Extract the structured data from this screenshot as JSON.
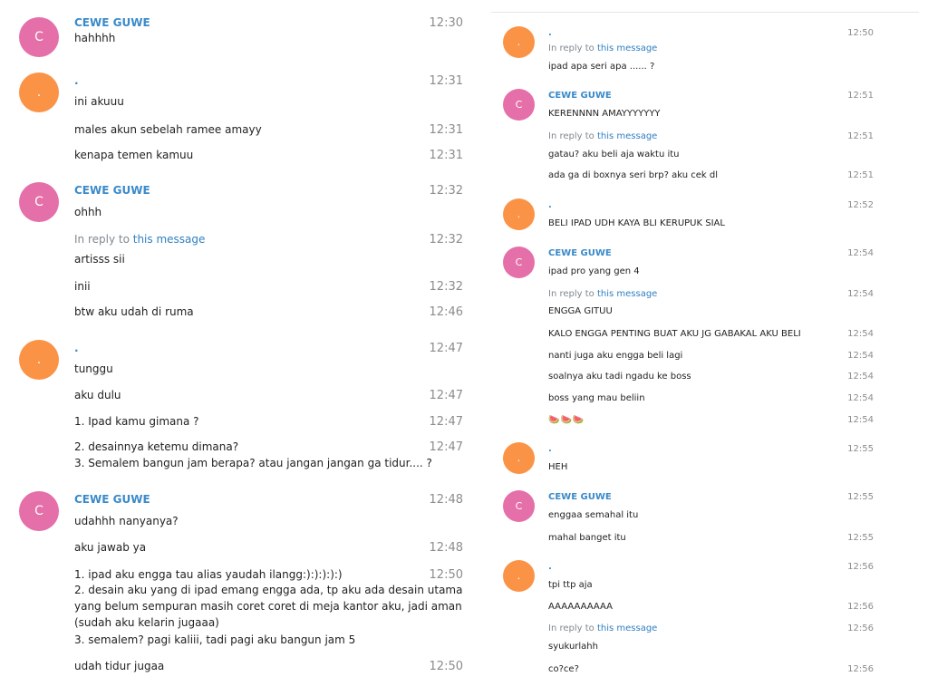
{
  "left": {
    "messages": [
      {
        "sender": "CEWE GUWE",
        "avatar": "C",
        "color": "pink",
        "lines": [
          {
            "text": "hahhhh",
            "time": "12:30"
          }
        ]
      },
      {
        "sender": ".",
        "avatar": ".",
        "color": "orange",
        "lines": [
          {
            "text": "ini akuuu",
            "time": "12:31"
          },
          {
            "text": "males akun sebelah ramee amayy",
            "time": "12:31"
          },
          {
            "text": "kenapa temen kamuu",
            "time": "12:31"
          }
        ]
      },
      {
        "sender": "CEWE GUWE",
        "avatar": "C",
        "color": "pink",
        "lines": [
          {
            "text": "ohhh",
            "time": "12:32"
          },
          {
            "reply": true,
            "time": "12:32"
          },
          {
            "text": "artisss sii"
          },
          {
            "text": "inii",
            "time": "12:32"
          },
          {
            "text": "btw aku udah di ruma",
            "time": "12:46"
          }
        ]
      },
      {
        "sender": ".",
        "avatar": ".",
        "color": "orange",
        "lines": [
          {
            "text": "tunggu",
            "time": "12:47"
          },
          {
            "text": "aku dulu",
            "time": "12:47"
          },
          {
            "text": "1. Ipad kamu gimana ?",
            "time": "12:47"
          },
          {
            "text": "2. desainnya ketemu dimana?",
            "time": "12:47"
          },
          {
            "text": "3. Semalem bangun jam berapa? atau jangan jangan ga tidur.... ?"
          }
        ]
      },
      {
        "sender": "CEWE GUWE",
        "avatar": "C",
        "color": "pink",
        "lines": [
          {
            "text": "udahhh nanyanya?",
            "time": "12:48"
          },
          {
            "text": "aku jawab ya",
            "time": "12:48"
          },
          {
            "text": "1. ipad aku engga tau alias yaudah ilangg:):):):):)",
            "time": "12:50"
          },
          {
            "text": "2. desain aku yang di ipad emang engga ada, tp aku ada desain utama"
          },
          {
            "text": "yang belum sempuran masih coret coret di meja kantor aku, jadi aman"
          },
          {
            "text": "(sudah aku kelarin jugaaa)"
          },
          {
            "text": "3. semalem? pagi kaliii, tadi pagi aku bangun jam 5"
          },
          {
            "text": "udah tidur jugaa",
            "time": "12:50"
          }
        ]
      }
    ]
  },
  "right": {
    "messages": [
      {
        "sender": ".",
        "avatar": ".",
        "color": "orange",
        "lines": [
          {
            "reply": true,
            "time": "12:50"
          },
          {
            "text": "ipad apa seri apa ...... ?"
          }
        ]
      },
      {
        "sender": "CEWE GUWE",
        "avatar": "C",
        "color": "pink",
        "lines": [
          {
            "text": "KERENNNN AMAYYYYYYY",
            "time": "12:51"
          },
          {
            "reply": true,
            "time": "12:51"
          },
          {
            "text": "gatau? aku beli aja waktu itu"
          },
          {
            "text": "ada ga di boxnya seri brp? aku cek dl",
            "time": "12:51"
          }
        ]
      },
      {
        "sender": ".",
        "avatar": ".",
        "color": "orange",
        "lines": [
          {
            "text": "BELI IPAD UDH KAYA BLI KERUPUK SIAL",
            "time": "12:52"
          }
        ]
      },
      {
        "sender": "CEWE GUWE",
        "avatar": "C",
        "color": "pink",
        "lines": [
          {
            "text": "ipad pro yang gen 4",
            "time": "12:54"
          },
          {
            "reply": true,
            "time": "12:54"
          },
          {
            "text": "ENGGA GITUU"
          },
          {
            "text": "KALO ENGGA PENTING BUAT AKU JG GABAKAL AKU BELI",
            "time": "12:54"
          },
          {
            "text": "nanti juga aku engga beli lagi",
            "time": "12:54"
          },
          {
            "text": "soalnya aku tadi ngadu ke boss",
            "time": "12:54"
          },
          {
            "text": "boss yang mau beliin",
            "time": "12:54"
          },
          {
            "text": "🍉🍉🍉",
            "time": "12:54",
            "emoji": true
          }
        ]
      },
      {
        "sender": ".",
        "avatar": ".",
        "color": "orange",
        "lines": [
          {
            "text": "HEH",
            "time": "12:55"
          }
        ]
      },
      {
        "sender": "CEWE GUWE",
        "avatar": "C",
        "color": "pink",
        "lines": [
          {
            "text": "enggaa semahal itu",
            "time": "12:55"
          },
          {
            "text": "mahal banget itu",
            "time": "12:55"
          }
        ]
      },
      {
        "sender": ".",
        "avatar": ".",
        "color": "orange",
        "lines": [
          {
            "text": "tpi ttp aja",
            "time": "12:56"
          },
          {
            "text": "AAAAAAAAAA",
            "time": "12:56"
          },
          {
            "reply": true,
            "time": "12:56"
          },
          {
            "text": "syukurlahh"
          },
          {
            "text": "co?ce?",
            "time": "12:56"
          }
        ]
      }
    ]
  },
  "reply_prefix": "In reply to",
  "reply_link": "this message",
  "colors": {
    "pink": "#e56fa8",
    "orange": "#fb9347",
    "sender": "#3a8ac9",
    "link": "#2f7fc2"
  }
}
